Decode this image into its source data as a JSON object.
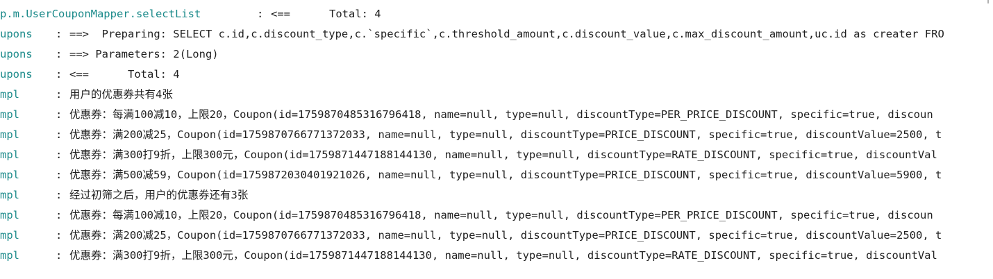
{
  "colors": {
    "logger": "#1b8a8a",
    "text": "#1f1f1f",
    "background": "#ffffff"
  },
  "lines": [
    {
      "logger": "p.m.UserCouponMapper.selectList",
      "sep": ":",
      "msg": "<==      Total: 4"
    },
    {
      "logger": "upons",
      "sep": ":",
      "msg": "==>  Preparing: SELECT c.id,c.discount_type,c.`specific`,c.threshold_amount,c.discount_value,c.max_discount_amount,uc.id as creater FRO"
    },
    {
      "logger": "upons",
      "sep": ":",
      "msg": "==> Parameters: 2(Long)"
    },
    {
      "logger": "upons",
      "sep": ":",
      "msg": "<==      Total: 4"
    },
    {
      "logger": "mpl",
      "sep": ":",
      "msg": "用户的优惠券共有4张"
    },
    {
      "logger": "mpl",
      "sep": ":",
      "msg": "优惠券：每满100减10，上限20，Coupon(id=1759870485316796418, name=null, type=null, discountType=PER_PRICE_DISCOUNT, specific=true, discoun"
    },
    {
      "logger": "mpl",
      "sep": ":",
      "msg": "优惠券：满200减25，Coupon(id=1759870766771372033, name=null, type=null, discountType=PRICE_DISCOUNT, specific=true, discountValue=2500, t"
    },
    {
      "logger": "mpl",
      "sep": ":",
      "msg": "优惠券：满300打9折，上限300元，Coupon(id=1759871447188144130, name=null, type=null, discountType=RATE_DISCOUNT, specific=true, discountVal"
    },
    {
      "logger": "mpl",
      "sep": ":",
      "msg": "优惠券：满500减59，Coupon(id=1759872030401921026, name=null, type=null, discountType=PRICE_DISCOUNT, specific=true, discountValue=5900, t"
    },
    {
      "logger": "mpl",
      "sep": ":",
      "msg": "经过初筛之后，用户的优惠券还有3张"
    },
    {
      "logger": "mpl",
      "sep": ":",
      "msg": "优惠券：每满100减10，上限20，Coupon(id=1759870485316796418, name=null, type=null, discountType=PER_PRICE_DISCOUNT, specific=true, discoun"
    },
    {
      "logger": "mpl",
      "sep": ":",
      "msg": "优惠券：满200减25，Coupon(id=1759870766771372033, name=null, type=null, discountType=PRICE_DISCOUNT, specific=true, discountValue=2500, t"
    },
    {
      "logger": "mpl",
      "sep": ":",
      "msg": "优惠券：满300打9折，上限300元，Coupon(id=1759871447188144130, name=null, type=null, discountType=RATE_DISCOUNT, specific=true, discountVal"
    }
  ]
}
